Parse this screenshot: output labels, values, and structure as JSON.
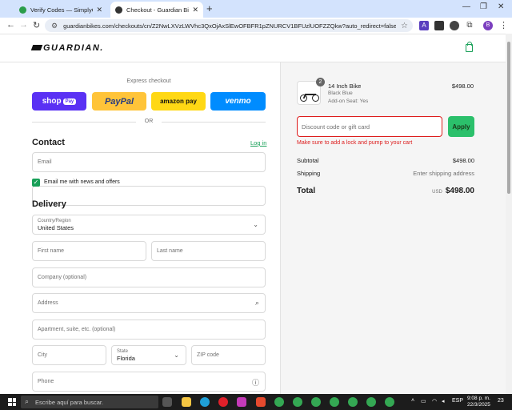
{
  "browser": {
    "tabs": [
      {
        "title": "Verify Codes — SimplyCodes",
        "active": false
      },
      {
        "title": "Checkout - Guardian Bikes®",
        "active": true
      }
    ],
    "url": "guardianbikes.com/checkouts/cn/Z2NwLXVzLWVhc3QxOjAxSlEwOFBFR1pZNURCV1BFUzlUOFZZQkw?auto_redirect=false&edge_red...",
    "profile_initial": "B"
  },
  "site": {
    "logo": "GUARDIAN.",
    "express_label": "Express checkout",
    "express_buttons": {
      "shop": "shop",
      "shop_pill": "Pay",
      "paypal": "PayPal",
      "amazon": "amazon pay",
      "venmo": "venmo"
    },
    "or_label": "OR",
    "contact": {
      "heading": "Contact",
      "login_link": "Log in",
      "email_placeholder": "Email",
      "newsletter_label": "Email me with news and offers",
      "newsletter_checked": true
    },
    "delivery": {
      "heading": "Delivery",
      "country_label": "Country/Region",
      "country_value": "United States",
      "first_name": "First name",
      "last_name": "Last name",
      "company": "Company (optional)",
      "address": "Address",
      "apartment": "Apartment, suite, etc. (optional)",
      "city": "City",
      "state_label": "State",
      "state_value": "Florida",
      "zip": "ZIP code",
      "phone": "Phone"
    }
  },
  "summary": {
    "item": {
      "name": "14 Inch Bike",
      "variant": "Black Blue",
      "addon": "Add-on Seat: Yes",
      "price": "$498.00",
      "quantity": "2"
    },
    "discount_placeholder": "Discount code or gift card",
    "apply_label": "Apply",
    "error": "Make sure to add a lock and pump to your cart",
    "subtotal_label": "Subtotal",
    "subtotal_value": "$498.00",
    "shipping_label": "Shipping",
    "shipping_value": "Enter shipping address",
    "total_label": "Total",
    "total_currency": "USD",
    "total_value": "$498.00"
  },
  "taskbar": {
    "search_placeholder": "Escribe aquí para buscar.",
    "language": "ESP",
    "time": "9:08 p. m.",
    "date": "22/3/2025",
    "notif_count": "23"
  },
  "colors": {
    "accent": "#18a058",
    "error": "#dd1d1d",
    "shop_pay": "#5a31f4",
    "paypal": "#ffc439",
    "amazon": "#ffd814",
    "venmo": "#008cff"
  }
}
